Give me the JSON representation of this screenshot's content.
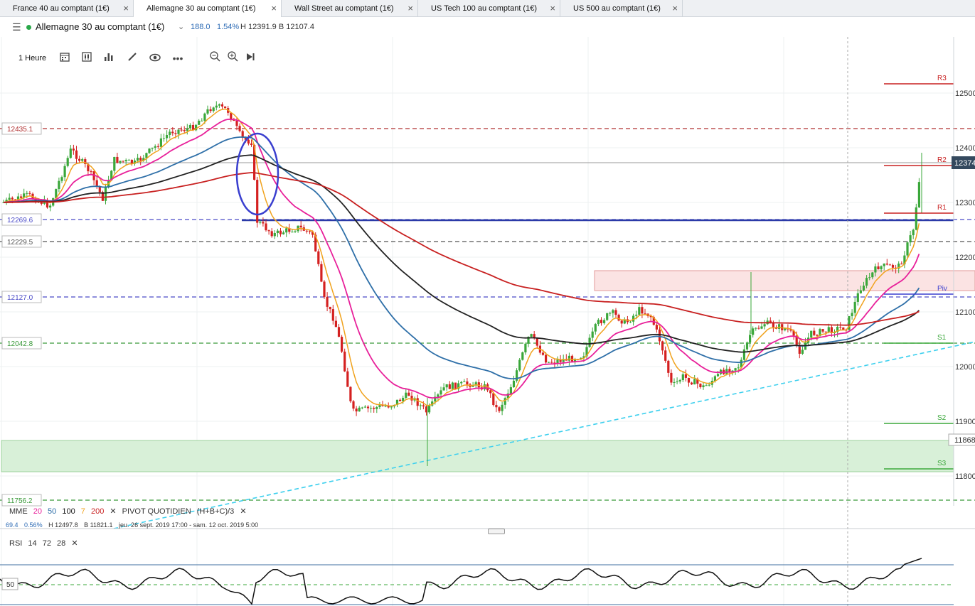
{
  "tabs": [
    {
      "label": "France 40 au comptant (1€)",
      "active": false
    },
    {
      "label": "Allemagne 30 au comptant (1€)",
      "active": true
    },
    {
      "label": "Wall Street au comptant (1€)",
      "active": false
    },
    {
      "label": "US Tech 100 au comptant (1€)",
      "active": false
    },
    {
      "label": "US 500 au comptant (1€)",
      "active": false
    }
  ],
  "tab_close_icon": "close-icon",
  "instrument": {
    "name": "Allemagne 30 au comptant (1€)",
    "change": "188.0",
    "change_pct": "1.54%",
    "high_low": "H 12391.9 B 12107.4",
    "status_color": "#2aa84a"
  },
  "toolbar": {
    "timeframe": "1 Heure",
    "icons": [
      "calendar-icon",
      "candle-type-icon",
      "indicators-icon",
      "draw-pencil-icon",
      "eye-icon",
      "more-icon",
      "zoom-out-icon",
      "zoom-in-icon",
      "jump-to-end-icon"
    ]
  },
  "price_axis": {
    "ticks": [
      "12500",
      "12400",
      "12300",
      "12200",
      "12100",
      "12000",
      "11900",
      "11800"
    ],
    "current_price": "12374",
    "marker_price": "11868"
  },
  "levels": {
    "left_labels": [
      "12435.1",
      "12269.6",
      "12229.5",
      "12127.0",
      "12042.8",
      "11756.2"
    ],
    "pivot_labels": [
      "R3",
      "R2",
      "R1",
      "Piv",
      "S1",
      "S2",
      "S3"
    ]
  },
  "overlay_legend": {
    "mme_label": "MME",
    "mme_periods": [
      "20",
      "50",
      "100",
      "7",
      "200"
    ],
    "pivot_label": "PIVOT QUOTIDIEN",
    "pivot_formula": "(H+B+C)/3",
    "close_symbol": "✕"
  },
  "stats": {
    "change": "69.4",
    "change_pct": "0.56%",
    "high": "H 12497.8",
    "low": "B 11821.1",
    "range": "jeu. 26 sept. 2019 17:00 - sam. 12 oct. 2019 5:00"
  },
  "rsi": {
    "label": "RSI",
    "params": [
      "14",
      "72",
      "28"
    ],
    "close_symbol": "✕",
    "level_label": "50"
  },
  "colors": {
    "bull": "#3aa73a",
    "bear": "#d42020",
    "ema7": "#f0a21c",
    "ema20": "#e8209a",
    "ema50": "#2e6fa8",
    "ema100": "#222222",
    "ema200": "#c82020",
    "trend": "#3fd0ee",
    "highlight": "#3a3fcf"
  }
}
